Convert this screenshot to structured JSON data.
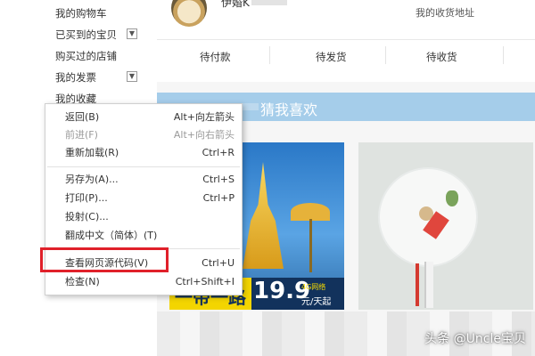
{
  "sidebar": {
    "items": [
      {
        "label": "我的购物车"
      },
      {
        "label": "已买到的宝贝",
        "toggle": "▼"
      },
      {
        "label": "购买过的店铺"
      },
      {
        "label": "我的发票",
        "toggle": "▼"
      },
      {
        "label": "我的收藏"
      }
    ]
  },
  "profile": {
    "username": "伊婚K",
    "address_link": "我的收货地址"
  },
  "order_tabs": [
    {
      "label": "待付款"
    },
    {
      "label": "待发货"
    },
    {
      "label": "待收货"
    }
  ],
  "recommend": {
    "title": "猜我喜欢"
  },
  "product1": {
    "slogan": "一带一路",
    "price": "19.9",
    "badge": "4G网络",
    "unit": "元/天起"
  },
  "context_menu": {
    "items": [
      {
        "label": "返回(B)",
        "shortcut": "Alt+向左箭头",
        "disabled": false
      },
      {
        "label": "前进(F)",
        "shortcut": "Alt+向右箭头",
        "disabled": true
      },
      {
        "label": "重新加载(R)",
        "shortcut": "Ctrl+R",
        "disabled": false
      },
      {
        "label": "另存为(A)...",
        "shortcut": "Ctrl+S",
        "disabled": false
      },
      {
        "label": "打印(P)...",
        "shortcut": "Ctrl+P",
        "disabled": false
      },
      {
        "label": "投射(C)...",
        "shortcut": "",
        "disabled": false
      },
      {
        "label": "翻成中文（简体）(T)",
        "shortcut": "",
        "disabled": false
      },
      {
        "label": "查看网页源代码(V)",
        "shortcut": "Ctrl+U",
        "disabled": false
      },
      {
        "label": "检查(N)",
        "shortcut": "Ctrl+Shift+I",
        "disabled": false
      }
    ]
  },
  "watermark": "头条 @Uncle宝贝",
  "colors": {
    "highlight": "#e0202a",
    "banner": "#a5cdea"
  }
}
